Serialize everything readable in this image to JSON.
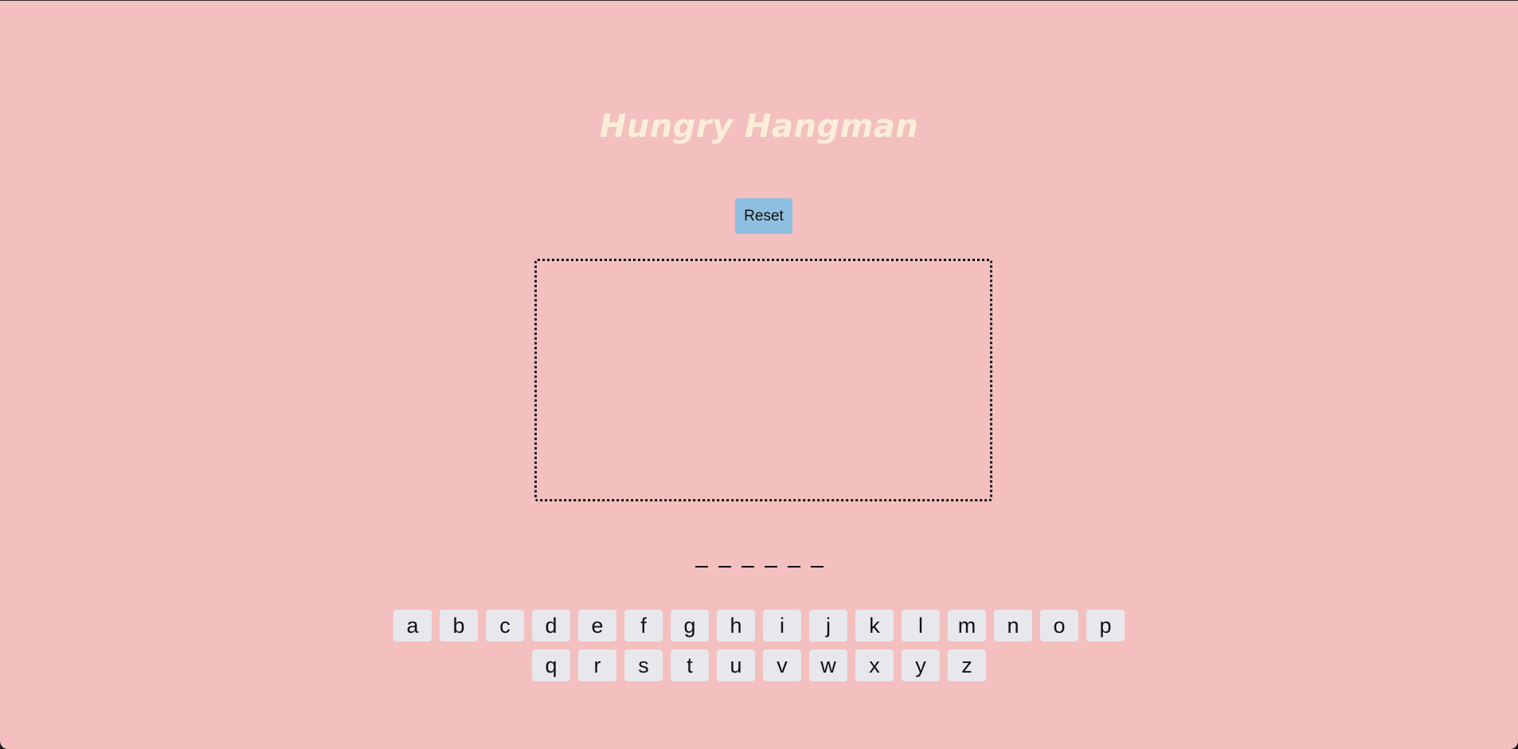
{
  "title": "Hungry Hangman",
  "reset_label": "Reset",
  "word_blanks": [
    "_",
    "_",
    "_",
    "_",
    "_",
    "_"
  ],
  "keyboard": {
    "row1": [
      "a",
      "b",
      "c",
      "d",
      "e",
      "f",
      "g",
      "h",
      "i",
      "j",
      "k",
      "l",
      "m",
      "n",
      "o",
      "p"
    ],
    "row2": [
      "q",
      "r",
      "s",
      "t",
      "u",
      "v",
      "w",
      "x",
      "y",
      "z"
    ]
  },
  "colors": {
    "background": "#f3c0bf",
    "title": "#fbeed8",
    "reset_button": "#8fbfe0",
    "key": "#e8e8ec"
  }
}
